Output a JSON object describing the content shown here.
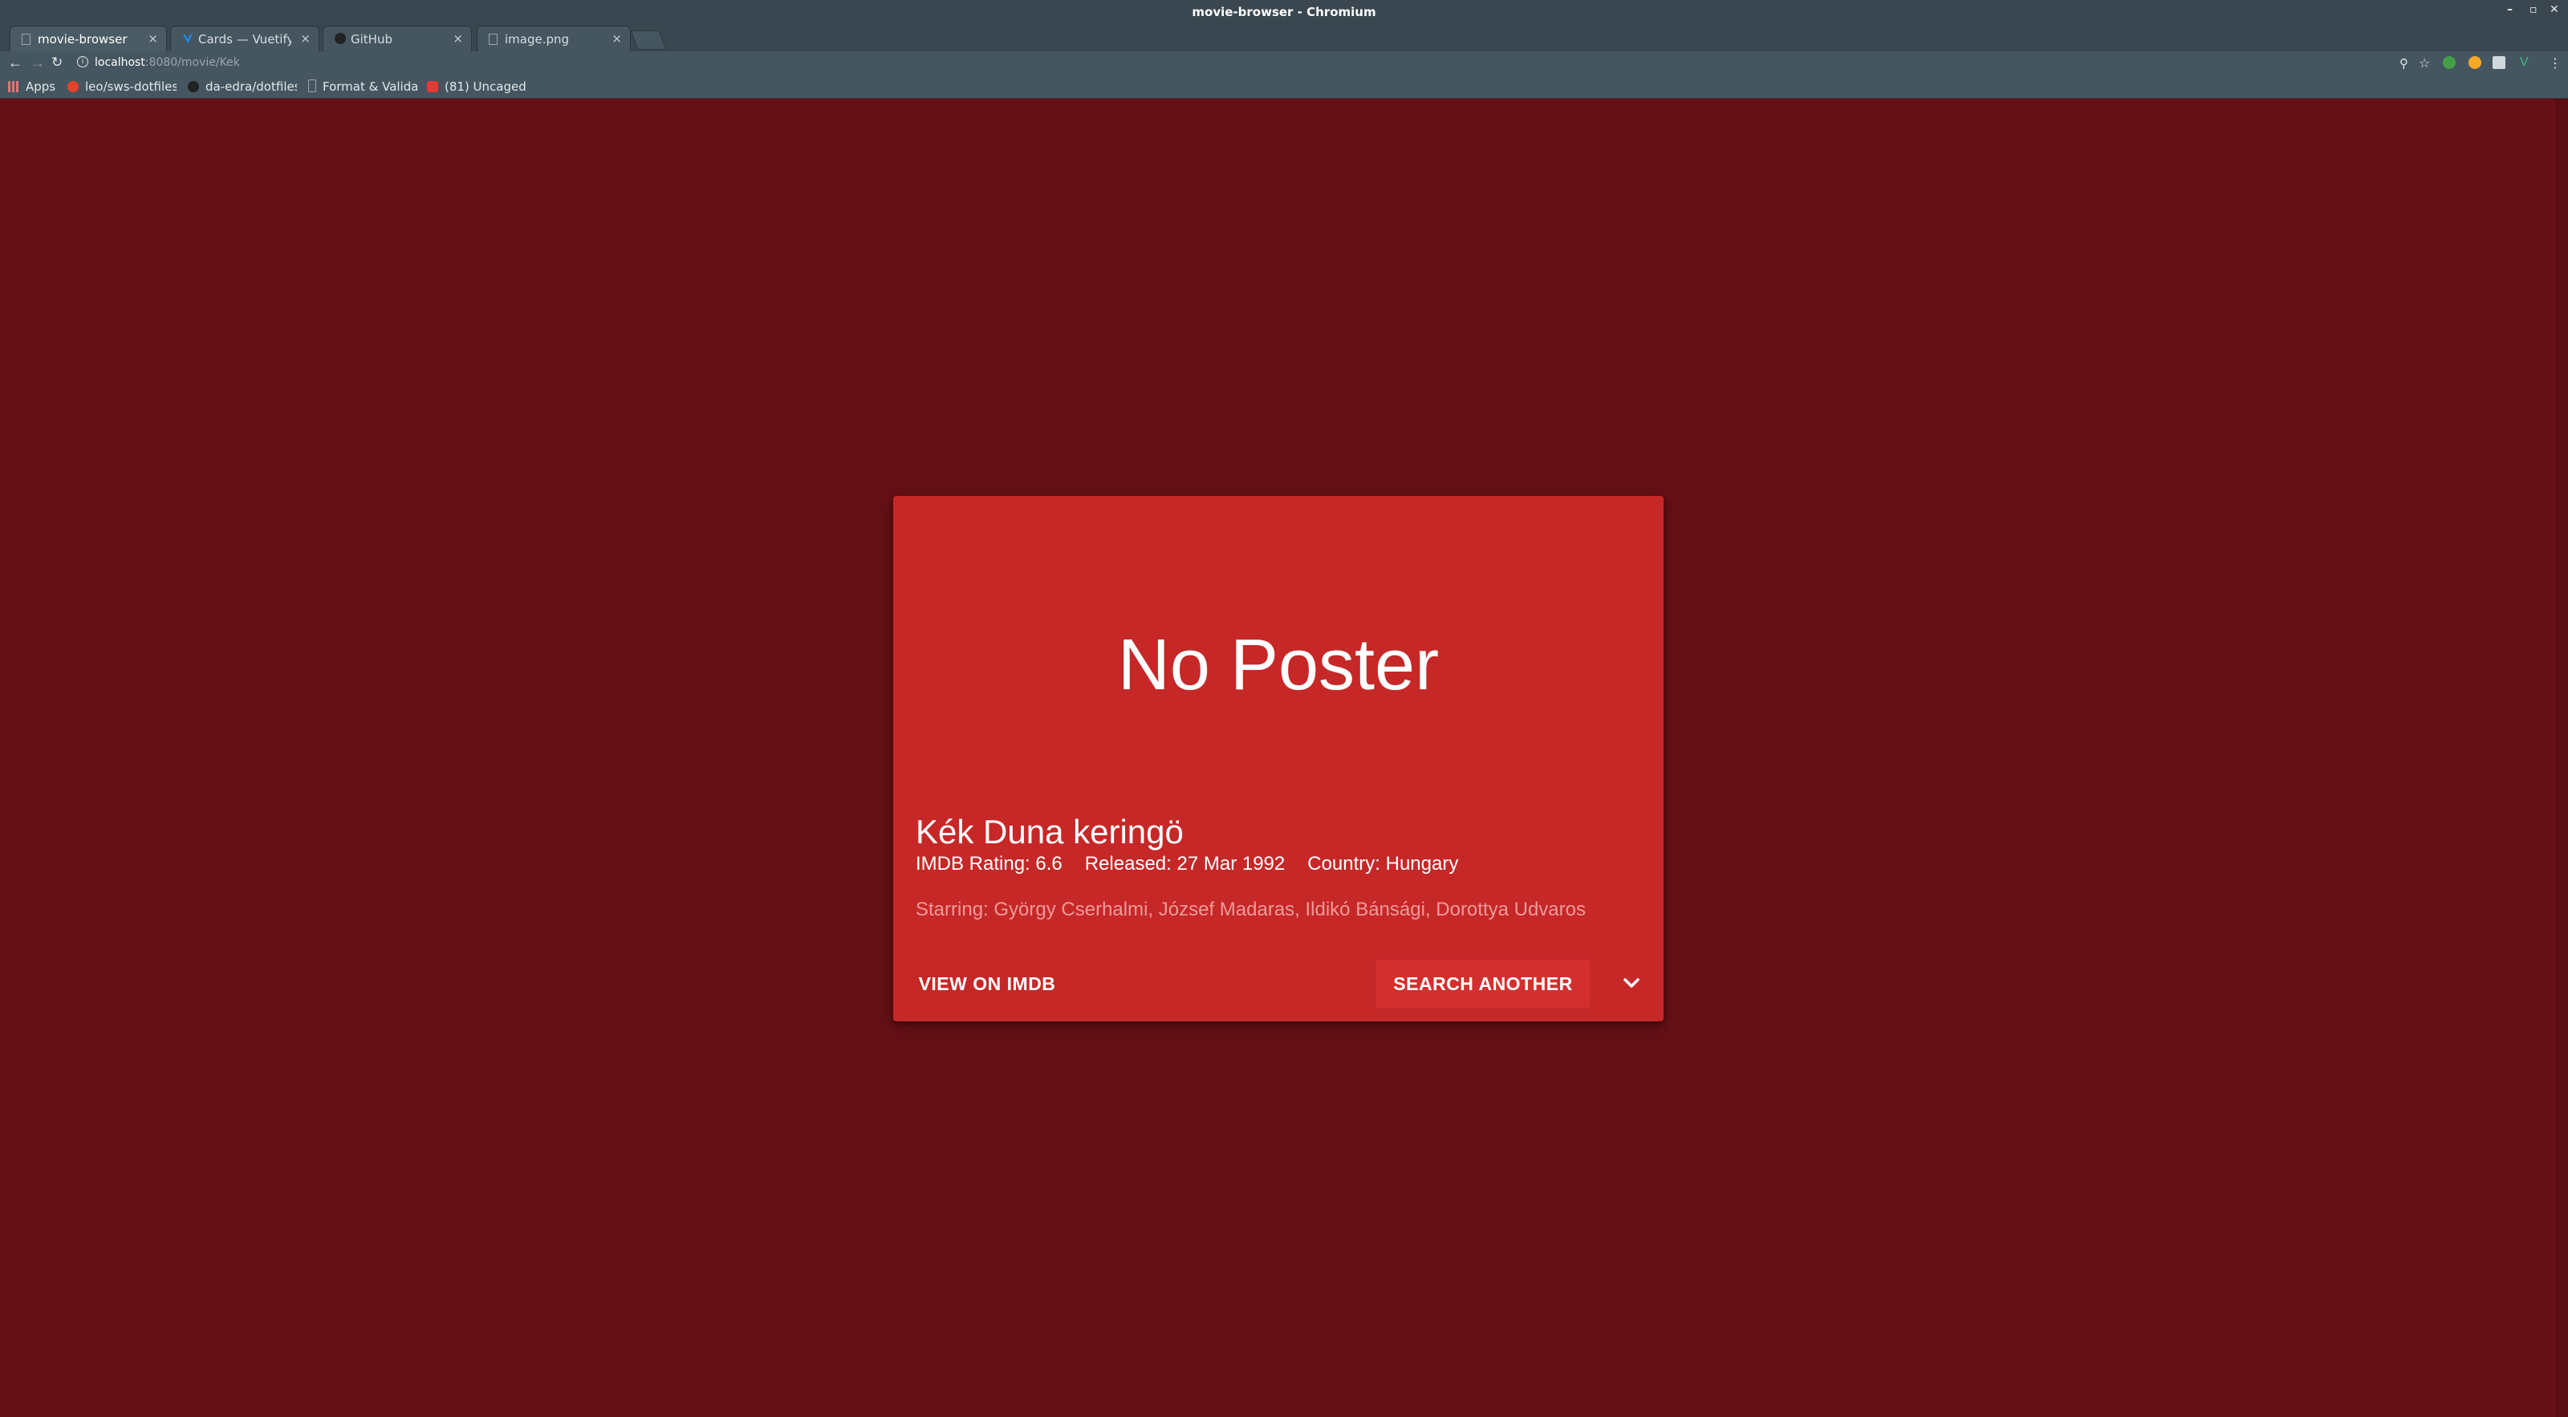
{
  "window": {
    "title": "movie-browser - Chromium"
  },
  "tabs": [
    {
      "label": "movie-browser",
      "active": true
    },
    {
      "label": "Cards — Vuetify.js",
      "active": false
    },
    {
      "label": "GitHub",
      "active": false
    },
    {
      "label": "image.png",
      "active": false
    }
  ],
  "address": {
    "host": "localhost",
    "path": ":8080/movie/Kek"
  },
  "bookmarks": [
    {
      "label": "Apps"
    },
    {
      "label": "leo/sws-dotfiles"
    },
    {
      "label": "da-edra/dotfiles"
    },
    {
      "label": "Format & Validate"
    },
    {
      "label": "(81) Uncaged"
    }
  ],
  "card": {
    "poster_placeholder": "No Poster",
    "title": "Kék Duna keringö",
    "rating": "IMDB Rating: 6.6",
    "released": "Released: 27 Mar 1992",
    "country": "Country: Hungary",
    "starring": "Starring: György Cserhalmi, József Madaras, Ildikó Bánsági, Dorottya Udvaros",
    "imdb_button": "VIEW ON IMDB",
    "search_button": "SEARCH ANOTHER"
  },
  "colors": {
    "page_background": "#641016",
    "card_background": "#c62828",
    "search_button": "#d32f2f"
  },
  "icons": [
    "back-icon",
    "forward-icon",
    "reload-icon",
    "info-icon",
    "zoom-icon",
    "star-icon",
    "menu-icon",
    "chevron-down-icon"
  ]
}
